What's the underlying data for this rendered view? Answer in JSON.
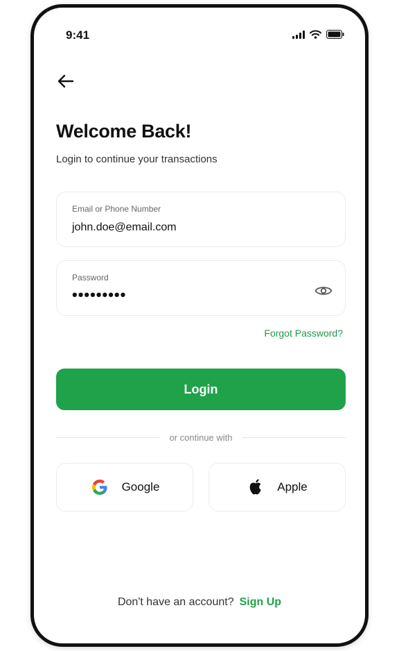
{
  "status_bar": {
    "time": "9:41"
  },
  "header": {
    "back_icon": "arrow-left-icon",
    "title": "Welcome Back!",
    "subtitle": "Login to continue your transactions"
  },
  "form": {
    "email": {
      "label": "Email or Phone Number",
      "value": "john.doe@email.com"
    },
    "password": {
      "label": "Password",
      "masked_value": "•••••••••",
      "toggle_icon": "eye-icon"
    },
    "forgot_label": "Forgot Password?",
    "login_label": "Login"
  },
  "divider": {
    "text": "or continue with"
  },
  "social": {
    "google": {
      "label": "Google",
      "icon": "google-icon"
    },
    "apple": {
      "label": "Apple",
      "icon": "apple-icon"
    }
  },
  "footer": {
    "prompt": "Don't have an account?",
    "link": "Sign Up"
  },
  "colors": {
    "accent": "#1fa24a",
    "text": "#111111",
    "border": "#ececec"
  }
}
